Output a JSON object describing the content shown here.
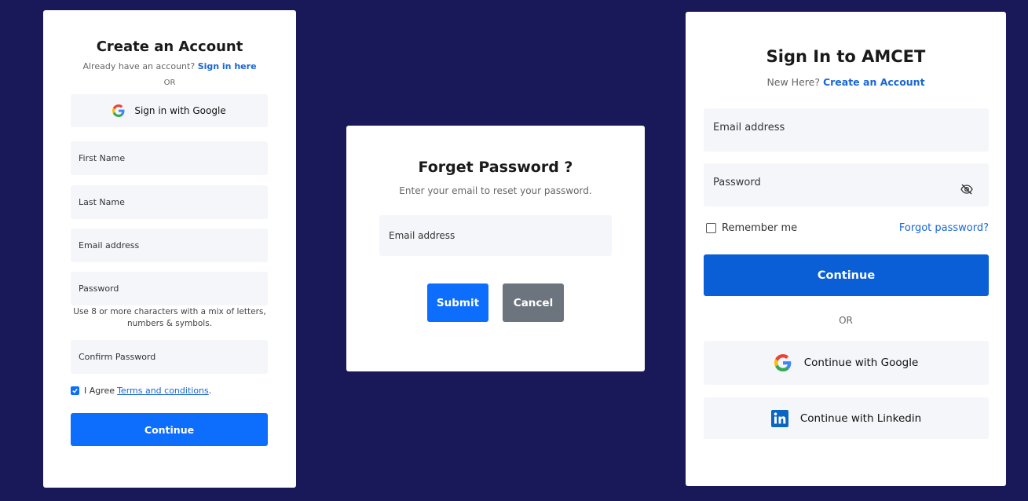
{
  "colors": {
    "background": "#19195a",
    "card": "#ffffff",
    "field": "#f4f6f9",
    "primary": "#0d6efd",
    "primary_dark": "#0a5fd6",
    "secondary": "#6c757d",
    "link": "#1967d2"
  },
  "create_account": {
    "title": "Create an Account",
    "already_prompt": "Already have an account?",
    "sign_in_link": "Sign in here",
    "or": "OR",
    "google_label": "Sign in with Google",
    "first_name_placeholder": "First Name",
    "last_name_placeholder": "Last Name",
    "email_placeholder": "Email address",
    "password_placeholder": "Password",
    "password_hint": "Use 8 or more characters with a mix of letters, numbers & symbols.",
    "confirm_password_placeholder": "Confirm Password",
    "agree_text": "I Agree",
    "terms_link": "Terms and conditions",
    "terms_period": ".",
    "agree_checked": true,
    "continue_label": "Continue"
  },
  "forgot_password": {
    "title": "Forget Password ?",
    "subtitle": "Enter your email to reset your password.",
    "email_placeholder": "Email address",
    "submit_label": "Submit",
    "cancel_label": "Cancel"
  },
  "sign_in": {
    "title": "Sign In to AMCET",
    "new_here": "New Here?",
    "create_link": "Create an Account",
    "email_placeholder": "Email address",
    "password_placeholder": "Password",
    "remember_label": "Remember me",
    "remember_checked": false,
    "forgot_link": "Forgot password?",
    "continue_label": "Continue",
    "or": "OR",
    "google_label": "Continue with Google",
    "linkedin_label": "Continue with Linkedin",
    "icons": {
      "password_toggle": "eye-slash-icon",
      "google": "google-icon",
      "linkedin": "linkedin-icon"
    }
  }
}
